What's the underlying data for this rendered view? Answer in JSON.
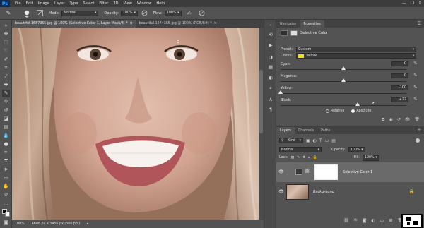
{
  "app": {
    "logo": "Ps"
  },
  "menubar": {
    "items": [
      "File",
      "Edit",
      "Image",
      "Layer",
      "Type",
      "Select",
      "Filter",
      "3D",
      "View",
      "Window",
      "Help"
    ],
    "controls": [
      "—",
      "❐",
      "✕"
    ]
  },
  "options": {
    "mode_label": "Mode:",
    "mode_value": "Normal",
    "opacity_label": "Opacity:",
    "opacity_value": "100%",
    "flow_label": "Flow:",
    "flow_value": "100%"
  },
  "doc_tabs": [
    {
      "label": "beautiful-1687955.jpg @ 100% (Selective Color 1, Layer Mask/8) *",
      "close": "×"
    },
    {
      "label": "beautiful-1274365.jpg @ 100% (RGB/8#) *",
      "close": "×"
    }
  ],
  "status": {
    "zoom": "100%",
    "doc_size": "4608 px x 3456 px (300 ppi)"
  },
  "properties": {
    "tabs": [
      "Navigator",
      "Properties"
    ],
    "title": "Selective Color",
    "preset_label": "Preset:",
    "preset_value": "Custom",
    "colors_label": "Colors:",
    "colors_value": "Yellow",
    "swatch_color": "#f2e400",
    "sliders": [
      {
        "label": "Cyan:",
        "value": "0",
        "unit": "%",
        "level": 0.5
      },
      {
        "label": "Magenta:",
        "value": "0",
        "unit": "%",
        "level": 0.5
      },
      {
        "label": "Yellow:",
        "value": "-100",
        "unit": "%",
        "level": 0.0
      },
      {
        "label": "Black:",
        "value": "+22",
        "unit": "%",
        "level": 0.61
      }
    ],
    "method_relative": "Relative",
    "method_absolute": "Absolute"
  },
  "layers": {
    "tabs": [
      "Layers",
      "Channels",
      "Paths"
    ],
    "filter_value": "Kind",
    "blend_mode": "Normal",
    "opacity_label": "Opacity:",
    "opacity_value": "100%",
    "lock_label": "Lock:",
    "fill_label": "Fill:",
    "fill_value": "100%",
    "items": [
      {
        "name": "Selective Color 1",
        "selected": true
      },
      {
        "name": "Background",
        "selected": false
      }
    ]
  }
}
